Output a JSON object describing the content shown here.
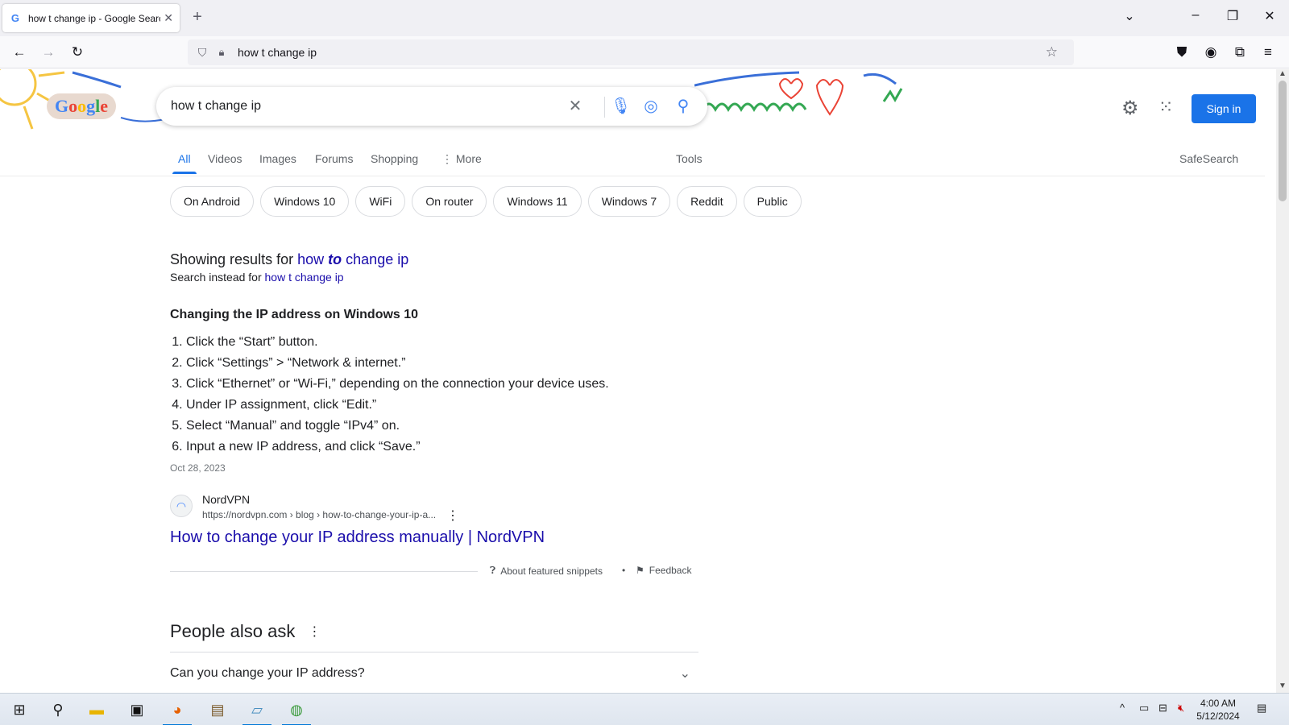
{
  "browser": {
    "tab_title": "how t change ip - Google Search",
    "url": "how t change ip"
  },
  "google": {
    "query": "how t change ip",
    "sign_in": "Sign in",
    "tabs": [
      "All",
      "Videos",
      "Images",
      "Forums",
      "Shopping",
      "More",
      "Tools",
      "SafeSearch"
    ],
    "chips": [
      "On Android",
      "Windows 10",
      "WiFi",
      "On router",
      "Windows 11",
      "Windows 7",
      "Reddit",
      "Public"
    ],
    "correction": {
      "prefix": "Showing results for",
      "w1": "how",
      "w2": "to",
      "w3": "change ip",
      "instead_prefix": "Search instead for",
      "instead_link": "how t change ip"
    },
    "snippet": {
      "title": "Changing the IP address on Windows 10",
      "steps": [
        "Click the “Start” button.",
        "Click “Settings” > “Network & internet.”",
        "Click “Ethernet” or “Wi-Fi,” depending on the connection your device uses.",
        "Under IP assignment, click “Edit.”",
        "Select “Manual” and toggle “IPv4” on.",
        "Input a new IP address, and click “Save.”"
      ],
      "date": "Oct 28, 2023",
      "source_name": "NordVPN",
      "source_url": "https://nordvpn.com › blog › how-to-change-your-ip-a...",
      "link_title": "How to change your IP address manually | NordVPN",
      "about": "About featured snippets",
      "dot": "•",
      "feedback": "Feedback"
    },
    "people_also_ask": {
      "heading": "People also ask",
      "questions": [
        "Can you change your IP address?"
      ]
    }
  },
  "taskbar": {
    "time": "4:00 AM",
    "date": "5/12/2024"
  },
  "colors": {
    "accent": "#1a73e8",
    "link": "#1a0dab"
  }
}
